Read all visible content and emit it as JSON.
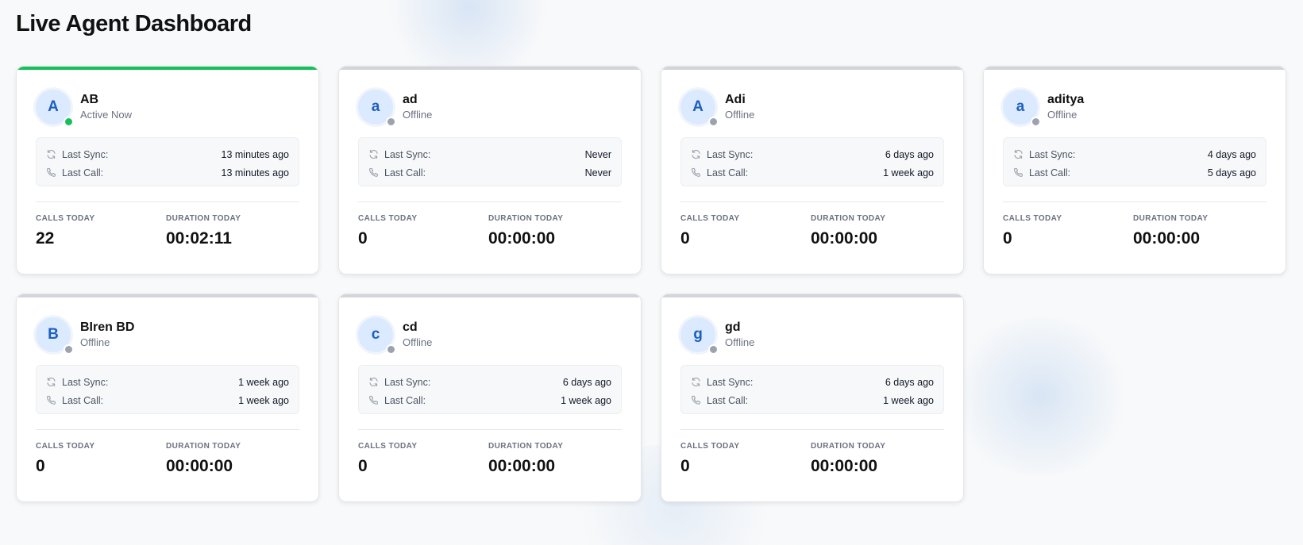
{
  "page": {
    "title": "Live Agent Dashboard"
  },
  "colors": {
    "active": "#16c05a",
    "offline": "#9ca3af",
    "avatar_bg": "#dbeafe",
    "avatar_text": "#1d5fbf"
  },
  "labels": {
    "last_sync": "Last Sync:",
    "last_call": "Last Call:",
    "calls_today": "CALLS TODAY",
    "duration_today": "DURATION TODAY"
  },
  "icons": {
    "sync": "refresh-icon",
    "call": "phone-icon"
  },
  "agents": [
    {
      "initial": "A",
      "name": "AB",
      "status": "Active Now",
      "active": true,
      "last_sync": "13 minutes ago",
      "last_call": "13 minutes ago",
      "calls_today": "22",
      "duration_today": "00:02:11"
    },
    {
      "initial": "a",
      "name": "ad",
      "status": "Offline",
      "active": false,
      "last_sync": "Never",
      "last_call": "Never",
      "calls_today": "0",
      "duration_today": "00:00:00"
    },
    {
      "initial": "A",
      "name": "Adi",
      "status": "Offline",
      "active": false,
      "last_sync": "6 days ago",
      "last_call": "1 week ago",
      "calls_today": "0",
      "duration_today": "00:00:00"
    },
    {
      "initial": "a",
      "name": "aditya",
      "status": "Offline",
      "active": false,
      "last_sync": "4 days ago",
      "last_call": "5 days ago",
      "calls_today": "0",
      "duration_today": "00:00:00"
    },
    {
      "initial": "B",
      "name": "BIren BD",
      "status": "Offline",
      "active": false,
      "last_sync": "1 week ago",
      "last_call": "1 week ago",
      "calls_today": "0",
      "duration_today": "00:00:00"
    },
    {
      "initial": "c",
      "name": "cd",
      "status": "Offline",
      "active": false,
      "last_sync": "6 days ago",
      "last_call": "1 week ago",
      "calls_today": "0",
      "duration_today": "00:00:00"
    },
    {
      "initial": "g",
      "name": "gd",
      "status": "Offline",
      "active": false,
      "last_sync": "6 days ago",
      "last_call": "1 week ago",
      "calls_today": "0",
      "duration_today": "00:00:00"
    }
  ]
}
